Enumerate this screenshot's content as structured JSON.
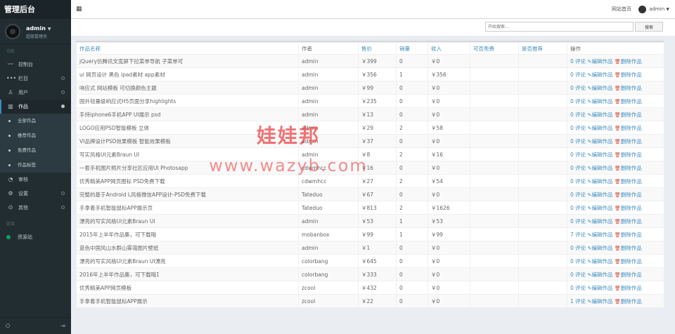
{
  "app": {
    "title": "管理后台"
  },
  "user": {
    "name": "admin",
    "role": "超级管理员"
  },
  "sidebar": {
    "section_main": "功能",
    "items": [
      {
        "label": "控制台",
        "icon": "chart-line-icon",
        "glyph": "〰"
      },
      {
        "label": "栏目",
        "icon": "dots-icon",
        "glyph": "•••"
      },
      {
        "label": "用户",
        "icon": "user-icon",
        "glyph": "♙"
      },
      {
        "label": "作品",
        "icon": "book-icon",
        "glyph": "▥"
      }
    ],
    "sub_items": [
      {
        "label": "全部作品"
      },
      {
        "label": "推荐作品"
      },
      {
        "label": "免费作品"
      },
      {
        "label": "作品标签"
      }
    ],
    "items_after": [
      {
        "label": "审核",
        "icon": "refresh-icon",
        "glyph": "◔"
      },
      {
        "label": "设置",
        "icon": "gear-icon",
        "glyph": "⚙"
      },
      {
        "label": "其他",
        "icon": "circle-question-icon",
        "glyph": "⊙"
      }
    ],
    "section_links": "链接",
    "links": [
      {
        "label": "资源站"
      }
    ]
  },
  "topbar": {
    "site_home": "网站首页",
    "user_label": "admin"
  },
  "search": {
    "placeholder": "开始搜索...",
    "button_label": "搜索"
  },
  "table": {
    "headers": [
      "作品名称",
      "作者",
      "售价",
      "销量",
      "收入",
      "可否免费",
      "是否推荐",
      "操作"
    ],
    "rows": [
      {
        "name": "jQuery仿腾讯文宽屏下拉菜单导航 子菜单可",
        "author": "admin",
        "price": "￥399",
        "sales": "0",
        "income": "￥0",
        "comments": "0 评论"
      },
      {
        "name": "ui 网页设计 黑色 ipad素材 app素材",
        "author": "admin",
        "price": "￥356",
        "sales": "1",
        "income": "￥356",
        "comments": "0 评论"
      },
      {
        "name": "响应式 网站模板 可切换颜色主题",
        "author": "admin",
        "price": "￥99",
        "sales": "0",
        "income": "￥0",
        "comments": "0 评论"
      },
      {
        "name": "国外轻量级响应式H5页面分享highlights",
        "author": "admin",
        "price": "￥235",
        "sales": "0",
        "income": "￥0",
        "comments": "0 评论"
      },
      {
        "name": "手持iphone6手机APP UI展示 psd",
        "author": "admin",
        "price": "￥13",
        "sales": "0",
        "income": "￥0",
        "comments": "0 评论"
      },
      {
        "name": "LOGO应用PSD智能模板 立体",
        "author": "admin",
        "price": "￥29",
        "sales": "2",
        "income": "￥58",
        "comments": "0 评论"
      },
      {
        "name": "VI品牌设计PSD效果模板 智能效果模板",
        "author": "admin",
        "price": "￥37",
        "sales": "0",
        "income": "￥0",
        "comments": "0 评论"
      },
      {
        "name": "写实风格UI元素Braun UI",
        "author": "admin",
        "price": "￥8",
        "sales": "2",
        "income": "￥16",
        "comments": "0 评论"
      },
      {
        "name": "一套手机图片照片分享社区应用UI Photosapp",
        "author": "cdwmhcc",
        "price": "￥16",
        "sales": "0",
        "income": "￥0",
        "comments": "0 评论"
      },
      {
        "name": "优秀精美APP网页图标 PSD免费下载",
        "author": "cdwmhcc",
        "price": "￥27",
        "sales": "2",
        "income": "￥54",
        "comments": "0 评论"
      },
      {
        "name": "完整的基于Android L风格微信APP设计-PSD免费下载",
        "author": "Tateduo",
        "price": "￥67",
        "sales": "0",
        "income": "￥0",
        "comments": "0 评论"
      },
      {
        "name": "手拿着手机智能鼠标APP展示页",
        "author": "Tateduo",
        "price": "￥813",
        "sales": "2",
        "income": "￥1626",
        "comments": "0 评论"
      },
      {
        "name": "漂亮的写实风格UI元素Braun UI",
        "author": "admin",
        "price": "￥53",
        "sales": "1",
        "income": "￥53",
        "comments": "0 评论"
      },
      {
        "name": "2015年上半年作品集，可下载哦",
        "author": "mobanbox",
        "price": "￥99",
        "sales": "1",
        "income": "￥99",
        "comments": "7 评论"
      },
      {
        "name": "蓝色中国风山水群山雾蔼图片壁纸",
        "author": "admin",
        "price": "￥1",
        "sales": "0",
        "income": "￥0",
        "comments": "0 评论"
      },
      {
        "name": "漂亮的写实风格UI元素Braun UI漂亮",
        "author": "colorbang",
        "price": "￥645",
        "sales": "0",
        "income": "￥0",
        "comments": "0 评论"
      },
      {
        "name": "2016年上半年作品集，可下载哦1",
        "author": "colorbang",
        "price": "￥333",
        "sales": "0",
        "income": "￥0",
        "comments": "0 评论"
      },
      {
        "name": "优秀精美APP网页模板",
        "author": "zcool",
        "price": "￥432",
        "sales": "0",
        "income": "￥0",
        "comments": "0 评论"
      },
      {
        "name": "手拿着手机智能鼠标APP展示",
        "author": "zcool",
        "price": "￥22",
        "sales": "0",
        "income": "￥0",
        "comments": "1 评论"
      }
    ],
    "edit_label": "编辑作品",
    "delete_label": "删除作品"
  },
  "watermark": {
    "cn": "娃娃邦",
    "url": "www.wazyb.com"
  },
  "colors": {
    "sidebar_bg": "#222d32",
    "accent": "#3c8dbc",
    "delete_icon": "#dd4b39",
    "link_dot": "#00a65a"
  }
}
